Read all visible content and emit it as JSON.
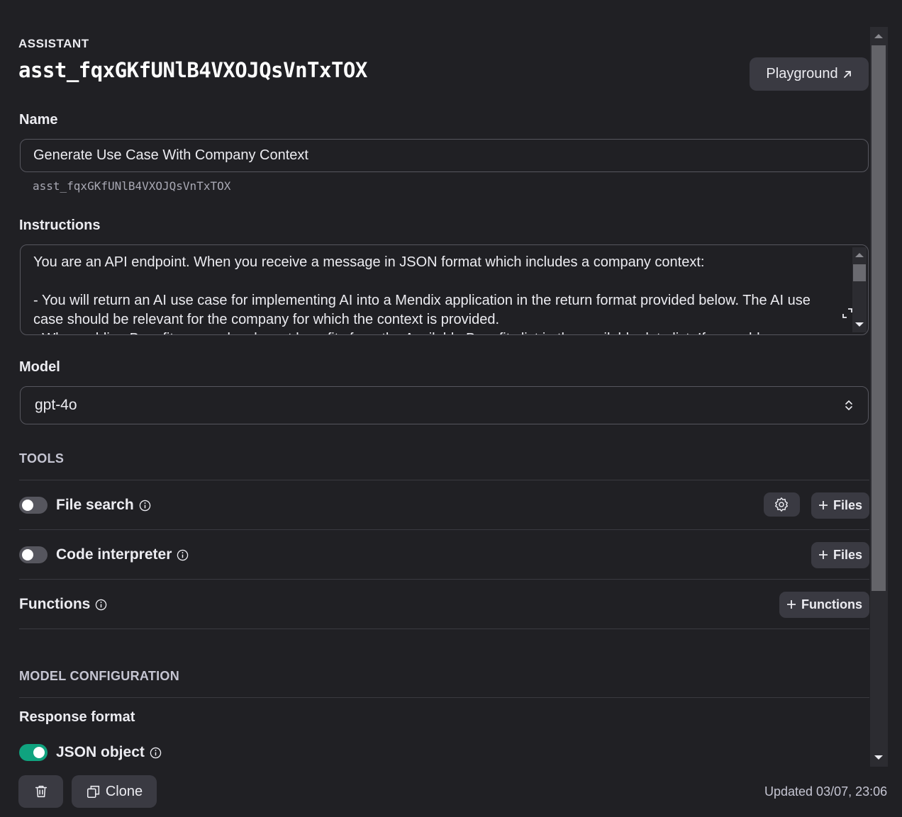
{
  "header": {
    "section_label": "ASSISTANT",
    "assistant_id": "asst_fqxGKfUNlB4VXOJQsVnTxTOX",
    "playground_label": "Playground"
  },
  "name": {
    "label": "Name",
    "value": "Generate Use Case With Company Context",
    "sub_id": "asst_fqxGKfUNlB4VXOJQsVnTxTOX"
  },
  "instructions": {
    "label": "Instructions",
    "value": "You are an API endpoint. When you receive a message in JSON format which includes a company context:\n\n- You will return an AI use case for implementing AI into a Mendix application in the return format provided below. The AI use case should be relevant for the company for which the context is provided.\n- When adding Benefits use only relevant benefits from the Available Benefits list in the available data list. If you add"
  },
  "model": {
    "label": "Model",
    "value": "gpt-4o"
  },
  "tools": {
    "section_label": "TOOLS",
    "file_search": {
      "label": "File search",
      "enabled": false,
      "files_label": "Files"
    },
    "code_interpreter": {
      "label": "Code interpreter",
      "enabled": false,
      "files_label": "Files"
    },
    "functions": {
      "label": "Functions",
      "add_label": "Functions"
    }
  },
  "model_configuration": {
    "section_label": "MODEL CONFIGURATION",
    "response_format_label": "Response format",
    "json_object": {
      "label": "JSON object",
      "enabled": true
    }
  },
  "footer": {
    "clone_label": "Clone",
    "updated_text": "Updated 03/07, 23:06"
  },
  "colors": {
    "background": "#202024",
    "accent_toggle_on": "#10a37f",
    "button_bg": "#3a3a42"
  }
}
